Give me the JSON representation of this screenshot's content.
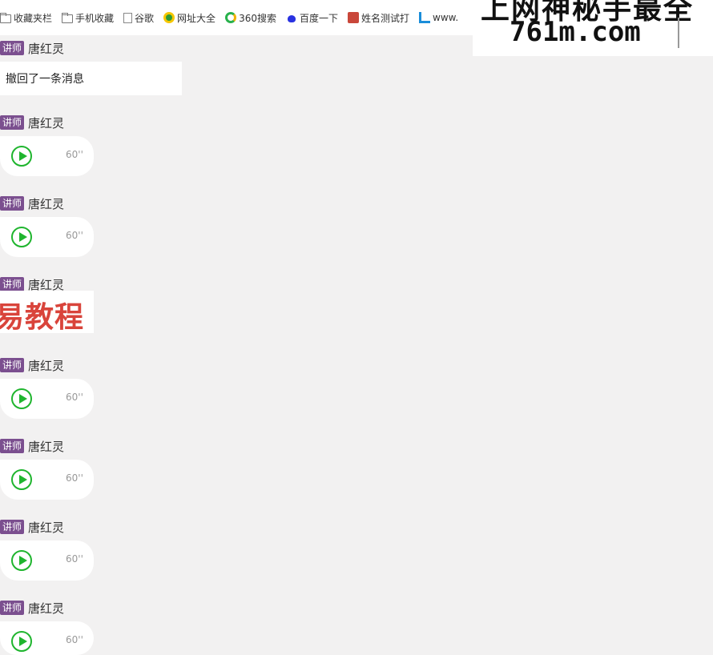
{
  "bookmarks": [
    {
      "label": "收藏夹栏",
      "icon": "folder-icon"
    },
    {
      "label": "手机收藏",
      "icon": "folder-icon"
    },
    {
      "label": "谷歌",
      "icon": "page-icon"
    },
    {
      "label": "网址大全",
      "icon": "nav-site-icon"
    },
    {
      "label": "360搜索",
      "icon": "search-360-icon"
    },
    {
      "label": "百度一下",
      "icon": "baidu-paw-icon"
    },
    {
      "label": "姓名测试打",
      "icon": "name-test-icon"
    },
    {
      "label": "www.",
      "icon": "crop-icon"
    }
  ],
  "watermark": {
    "top_text": "上网神秘手最全",
    "domain": "761m.com"
  },
  "messages": [
    {
      "type": "text",
      "badge": "讲师",
      "sender": "唐红灵",
      "text": "撤回了一条消息"
    },
    {
      "type": "voice",
      "badge": "讲师",
      "sender": "唐红灵",
      "duration": "60''"
    },
    {
      "type": "voice",
      "badge": "讲师",
      "sender": "唐红灵",
      "duration": "60''"
    },
    {
      "type": "image",
      "badge": "讲师",
      "sender": "唐红灵",
      "image_text": "易教程"
    },
    {
      "type": "voice",
      "badge": "讲师",
      "sender": "唐红灵",
      "duration": "60''"
    },
    {
      "type": "voice",
      "badge": "讲师",
      "sender": "唐红灵",
      "duration": "60''"
    },
    {
      "type": "voice",
      "badge": "讲师",
      "sender": "唐红灵",
      "duration": "60''"
    },
    {
      "type": "voice",
      "badge": "讲师",
      "sender": "唐红灵",
      "duration": "60''"
    }
  ],
  "colors": {
    "badge": "#7b4f8f",
    "play": "#1fb52e",
    "background": "#f2f1f1"
  }
}
